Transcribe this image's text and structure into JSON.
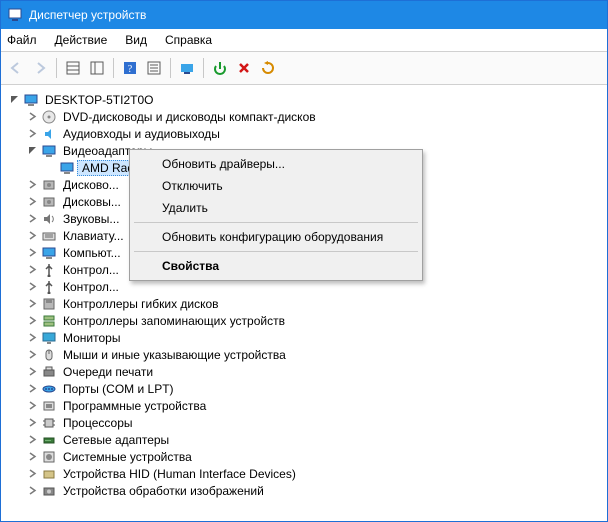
{
  "window": {
    "title": "Диспетчер устройств"
  },
  "menu": {
    "file": "Файл",
    "action": "Действие",
    "view": "Вид",
    "help": "Справка"
  },
  "tree": {
    "root": "DESKTOP-5TI2T0O",
    "categories": [
      {
        "label": "DVD-дисководы и дисководы компакт-дисков"
      },
      {
        "label": "Аудиовходы и аудиовыходы"
      },
      {
        "label": "Видеоадаптеры",
        "expanded": true,
        "children": [
          {
            "label": "AMD Radeon HD 6570",
            "selected": true
          }
        ]
      },
      {
        "label": "Дисково..."
      },
      {
        "label": "Дисковы..."
      },
      {
        "label": "Звуковы..."
      },
      {
        "label": "Клавиату..."
      },
      {
        "label": "Компьют..."
      },
      {
        "label": "Контрол..."
      },
      {
        "label": "Контрол..."
      },
      {
        "label": "Контроллеры гибких дисков"
      },
      {
        "label": "Контроллеры запоминающих устройств"
      },
      {
        "label": "Мониторы"
      },
      {
        "label": "Мыши и иные указывающие устройства"
      },
      {
        "label": "Очереди печати"
      },
      {
        "label": "Порты (COM и LPT)"
      },
      {
        "label": "Программные устройства"
      },
      {
        "label": "Процессоры"
      },
      {
        "label": "Сетевые адаптеры"
      },
      {
        "label": "Системные устройства"
      },
      {
        "label": "Устройства HID (Human Interface Devices)"
      },
      {
        "label": "Устройства обработки изображений"
      }
    ]
  },
  "context_menu": {
    "update_drivers": "Обновить драйверы...",
    "disable": "Отключить",
    "remove": "Удалить",
    "scan_hw": "Обновить конфигурацию оборудования",
    "properties": "Свойства"
  }
}
